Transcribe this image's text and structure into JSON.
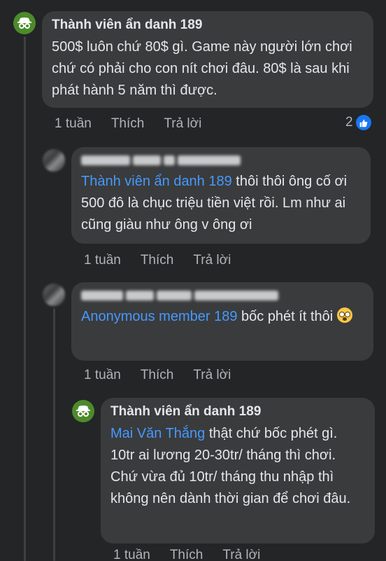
{
  "comments": [
    {
      "author": "Thành viên ẩn danh 189",
      "text": "500$ luôn chứ 80$ gì. Game này người lớn chơi chứ có phải cho con nít chơi đâu. 80$ là sau khi phát hành 5 năm thì được.",
      "time": "1 tuần",
      "like_label": "Thích",
      "reply_label": "Trả lời",
      "reaction_count": "2"
    },
    {
      "author_blurred": true,
      "mention": "Thành viên ẩn danh 189",
      "text": " thôi thôi ông cố ơi 500 đô là chục triệu tiền việt rồi. Lm như ai cũng giàu như ông v ông ơi",
      "time": "1 tuần",
      "like_label": "Thích",
      "reply_label": "Trả lời"
    },
    {
      "author_blurred": true,
      "mention": "Anonymous member 189",
      "text": " bốc phét ít thôi",
      "emoji": "flushed-face",
      "time": "1 tuần",
      "like_label": "Thích",
      "reply_label": "Trả lời"
    },
    {
      "author": "Thành viên ẩn danh 189",
      "mention": "Mai Văn Thắng",
      "text": " thật chứ bốc phét gì. 10tr ai lương 20-30tr/ tháng thì chơi. Chứ vừa đủ 10tr/ tháng thu nhập thì không nên dành thời gian để chơi đâu.",
      "time": "1 tuần",
      "like_label": "Thích",
      "reply_label": "Trả lời"
    }
  ],
  "colors": {
    "background": "#242526",
    "bubble": "#3a3b3c",
    "mention": "#4599ff",
    "anon_avatar": "#4c8b2b",
    "reaction": "#1877f2"
  }
}
